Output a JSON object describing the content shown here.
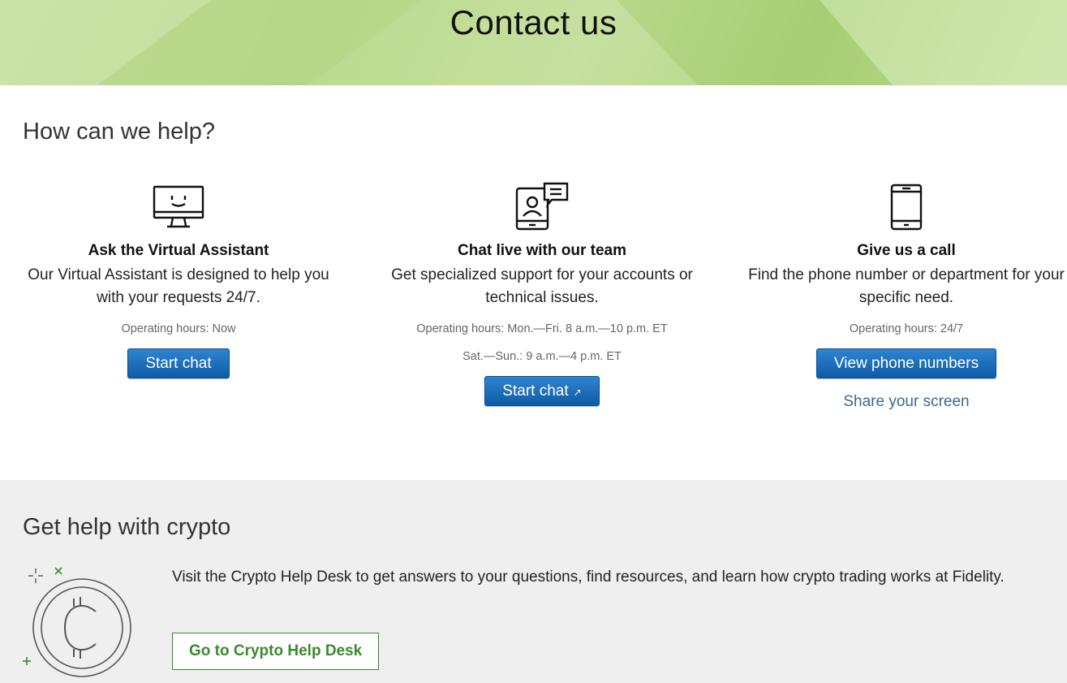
{
  "page": {
    "title": "Contact us"
  },
  "help": {
    "title": "How can we help?",
    "options": [
      {
        "icon": "monitor-smile-icon",
        "heading": "Ask the Virtual Assistant",
        "description": "Our Virtual Assistant is designed to help you with your requests 24/7.",
        "hours": "Operating hours: Now",
        "button": "Start chat"
      },
      {
        "icon": "tablet-chat-icon",
        "heading": "Chat live with our team",
        "description": "Get specialized support for your accounts or technical issues.",
        "hours": "Operating hours: Mon.—Fri. 8 a.m.—10 p.m. ET",
        "hours2": "Sat.—Sun.: 9 a.m.—4 p.m. ET",
        "button": "Start chat",
        "button_icon": "external-window-icon"
      },
      {
        "icon": "phone-icon",
        "heading": "Give us a call",
        "description": "Find the phone number or department for your specific need.",
        "hours": "Operating hours: 24/7",
        "button": "View phone numbers",
        "link": "Share your screen"
      }
    ]
  },
  "crypto": {
    "title": "Get help with crypto",
    "icon": "crypto-coin-icon",
    "text": "Visit the Crypto Help Desk to get answers to your questions, find resources, and learn how crypto trading works at Fidelity.",
    "button": "Go to Crypto Help Desk"
  },
  "colors": {
    "primary_button": "#0e5ba6",
    "link": "#3a6a8f",
    "crypto_accent": "#3b8a2e",
    "hero_green": "#b3d583",
    "gray_band": "#efefef"
  }
}
